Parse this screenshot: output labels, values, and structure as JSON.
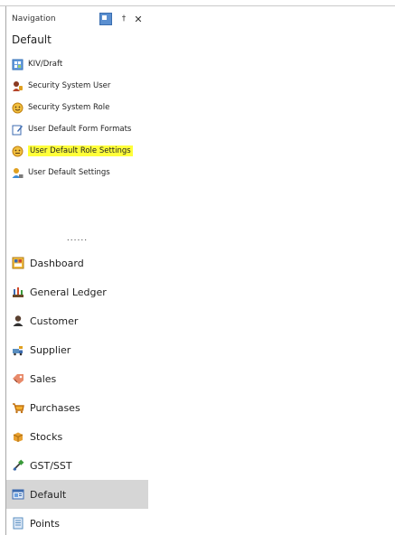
{
  "panel": {
    "title": "Navigation",
    "group_title": "Default",
    "items": [
      {
        "label": "KIV/Draft",
        "icon": "kiv-draft-icon",
        "color": "#3c8bd6",
        "highlighted": false
      },
      {
        "label": "Security System User",
        "icon": "security-user-icon",
        "color": "#b5442a",
        "highlighted": false
      },
      {
        "label": "Security System Role",
        "icon": "security-role-icon",
        "color": "#e0a020",
        "highlighted": false
      },
      {
        "label": "User Default Form Formats",
        "icon": "form-format-icon",
        "color": "#3c6bb0",
        "highlighted": false
      },
      {
        "label": "User Default Role Settings",
        "icon": "role-settings-icon",
        "color": "#e0a020",
        "highlighted": true
      },
      {
        "label": "User Default Settings",
        "icon": "user-settings-icon",
        "color": "#3c8bd6",
        "highlighted": false
      }
    ],
    "overflow_dots": "......",
    "highlight_color": "#ffff3a"
  },
  "modules": [
    {
      "label": "Dashboard",
      "icon": "dashboard-icon",
      "selected": false
    },
    {
      "label": "General Ledger",
      "icon": "general-ledger-icon",
      "selected": false
    },
    {
      "label": "Customer",
      "icon": "customer-icon",
      "selected": false
    },
    {
      "label": "Supplier",
      "icon": "supplier-icon",
      "selected": false
    },
    {
      "label": "Sales",
      "icon": "sales-icon",
      "selected": false
    },
    {
      "label": "Purchases",
      "icon": "purchases-icon",
      "selected": false
    },
    {
      "label": "Stocks",
      "icon": "stocks-icon",
      "selected": false
    },
    {
      "label": "GST/SST",
      "icon": "gst-sst-icon",
      "selected": false
    },
    {
      "label": "Default",
      "icon": "default-icon",
      "selected": true
    },
    {
      "label": "Points",
      "icon": "points-icon",
      "selected": false
    }
  ],
  "colors": {
    "selected_bg": "#d6d6d6",
    "border": "#a8a8a8"
  }
}
